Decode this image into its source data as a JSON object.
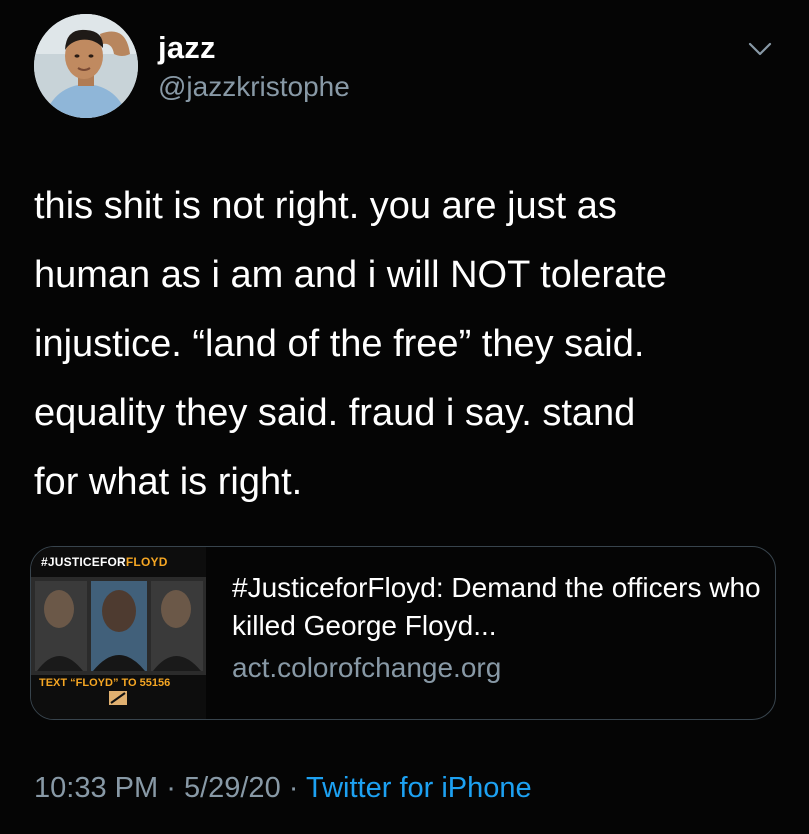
{
  "author": {
    "display_name": "jazz",
    "handle": "@jazzkristophe"
  },
  "tweet": {
    "text": "this shit is not right. you are just as\nhuman as i am and i will NOT tolerate\ninjustice. “land of the free” they said.\nequality they said. fraud i say. stand\nfor what is right."
  },
  "card": {
    "image_caption_top_a": "#JUSTICEFOR",
    "image_caption_top_b": "FLOYD",
    "image_caption_bottom": "TEXT “FLOYD” TO 55156",
    "title": "#JusticeforFloyd: Demand the officers who killed George Floyd...",
    "domain": "act.colorofchange.org"
  },
  "footer": {
    "time": "10:33 PM",
    "date": "5/29/20",
    "separator": "·",
    "source": "Twitter for iPhone"
  },
  "colors": {
    "background": "#000000",
    "text": "#ffffff",
    "secondary": "#8899a6",
    "link": "#1da1f2",
    "card_border": "#38444d",
    "card_accent": "#f5a623"
  },
  "icons": {
    "menu": "chevron-down-icon"
  }
}
